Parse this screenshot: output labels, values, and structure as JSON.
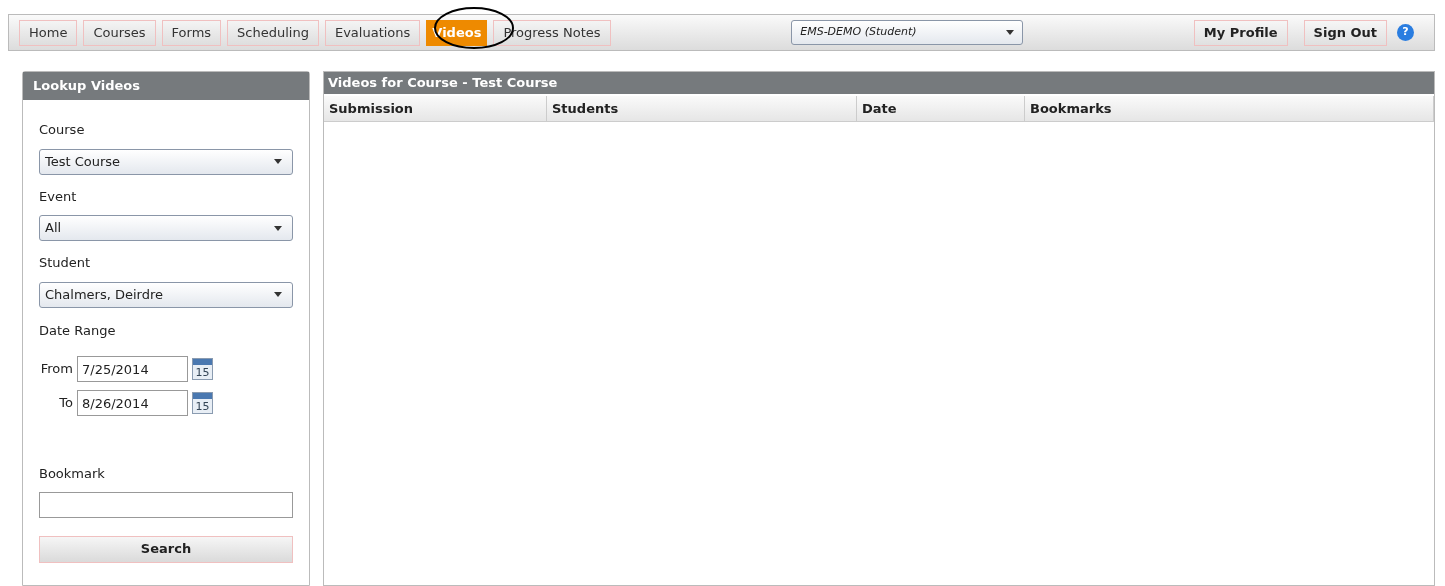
{
  "nav": {
    "tabs": [
      {
        "label": "Home",
        "selected": false
      },
      {
        "label": "Courses",
        "selected": false
      },
      {
        "label": "Forms",
        "selected": false
      },
      {
        "label": "Scheduling",
        "selected": false
      },
      {
        "label": "Evaluations",
        "selected": false
      },
      {
        "label": "Videos",
        "selected": true
      },
      {
        "label": "Progress Notes",
        "selected": false
      }
    ],
    "account_select": "EMS-DEMO (Student)",
    "buttons": [
      "My Profile",
      "Sign Out"
    ],
    "help": "?"
  },
  "lookup": {
    "title": "Lookup Videos",
    "selects": [
      {
        "label": "Course",
        "value": "Test Course"
      },
      {
        "label": "Event",
        "value": "All"
      },
      {
        "label": "Student",
        "value": "Chalmers, Deirdre"
      }
    ],
    "date_range": {
      "label": "Date Range",
      "from_label": "From",
      "from": "7/25/2014",
      "from_calendar_day": "15",
      "to_label": "To",
      "to": "8/26/2014",
      "to_calendar_day": "15"
    },
    "bookmark_label": "Bookmark",
    "search_button": "Search"
  },
  "results": {
    "title": "Videos for Course - Test Course",
    "columns": [
      "Submission",
      "Students",
      "Date",
      "Bookmarks"
    ]
  }
}
